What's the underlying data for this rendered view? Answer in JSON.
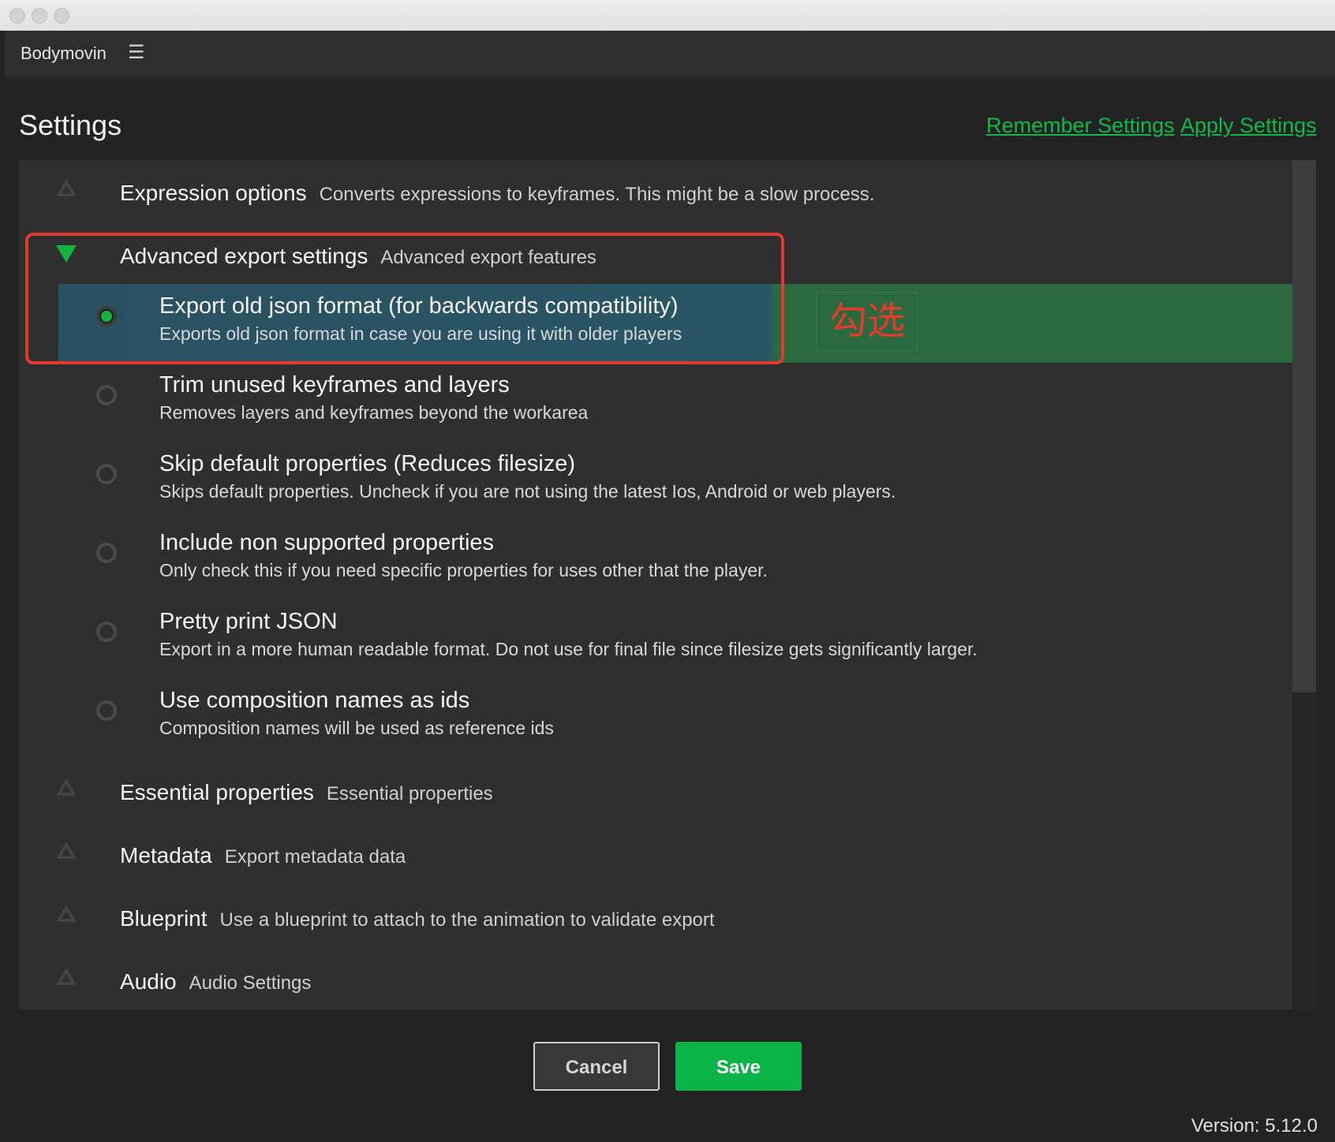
{
  "app": {
    "name": "Bodymovin",
    "menu_icon": "hamburger-icon"
  },
  "header": {
    "title": "Settings",
    "remember_label": "Remember Settings",
    "apply_label": "Apply Settings"
  },
  "sections": {
    "expression": {
      "title": "Expression options",
      "desc": "Converts expressions to keyframes. This might be a slow process.",
      "expanded": false
    },
    "advanced": {
      "title": "Advanced export settings",
      "desc": "Advanced export features",
      "expanded": true
    },
    "essential": {
      "title": "Essential properties",
      "desc": "Essential properties",
      "expanded": false
    },
    "metadata": {
      "title": "Metadata",
      "desc": "Export metadata data",
      "expanded": false
    },
    "blueprint": {
      "title": "Blueprint",
      "desc": "Use a blueprint to attach to the animation to validate export",
      "expanded": false
    },
    "audio": {
      "title": "Audio",
      "desc": "Audio Settings",
      "expanded": false
    }
  },
  "advanced_options": [
    {
      "title": "Export old json format (for backwards compatibility)",
      "desc": "Exports old json format in case you are using it with older players",
      "checked": true
    },
    {
      "title": "Trim unused keyframes and layers",
      "desc": "Removes layers and keyframes beyond the workarea",
      "checked": false
    },
    {
      "title": "Skip default properties (Reduces filesize)",
      "desc": "Skips default properties. Uncheck if you are not using the latest Ios, Android or web players.",
      "checked": false
    },
    {
      "title": "Include non supported properties",
      "desc": "Only check this if you need specific properties for uses other that the player.",
      "checked": false
    },
    {
      "title": "Pretty print JSON",
      "desc": "Export in a more human readable format. Do not use for final file since filesize gets significantly larger.",
      "checked": false
    },
    {
      "title": "Use composition names as ids",
      "desc": "Composition names will be used as reference ids",
      "checked": false
    }
  ],
  "annotation": {
    "label": "勾选"
  },
  "buttons": {
    "cancel": "Cancel",
    "save": "Save"
  },
  "footer": {
    "version": "Version: 5.12.0"
  },
  "colors": {
    "accent": "#0bb447",
    "annotation": "#e23a2e",
    "background": "#232323",
    "panel": "#2f2f2f"
  }
}
